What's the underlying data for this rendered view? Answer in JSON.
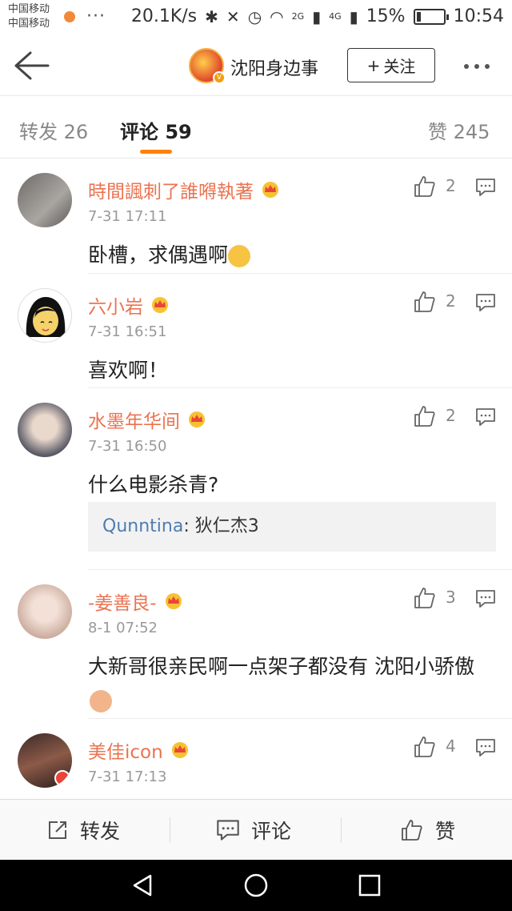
{
  "status_bar": {
    "carrier1": "中国移动",
    "carrier2": "中国移动",
    "dots": "···",
    "speed": "20.1K/s",
    "net1": "2G",
    "net2": "4G",
    "battery": "15%",
    "time": "10:54"
  },
  "nav": {
    "title": "沈阳身边事",
    "follow_label": "关注",
    "follow_plus": "+"
  },
  "tabs": [
    {
      "label": "转发",
      "count": "26"
    },
    {
      "label": "评论",
      "count": "59"
    },
    {
      "label": "赞",
      "count": "245"
    }
  ],
  "comments": [
    {
      "user": "時間諷刺了誰嘚執著",
      "time": "7-31 17:11",
      "text": "卧槽，求偶遇啊",
      "likes": "2"
    },
    {
      "user": "六小岩",
      "time": "7-31 16:51",
      "text": "喜欢啊！",
      "likes": "2"
    },
    {
      "user": "水墨年华间",
      "time": "7-31 16:50",
      "text": "什么电影杀青?",
      "likes": "2",
      "reply": {
        "user": "Qunntina",
        "sep": ": ",
        "text": "狄仁杰3"
      }
    },
    {
      "user": "-姜善良-",
      "time": "8-1 07:52",
      "text": "大新哥很亲民啊一点架子都没有 沈阳小骄傲",
      "likes": "3"
    },
    {
      "user": "美佳icon",
      "time": "7-31 17:13",
      "text": "",
      "likes": "4"
    }
  ],
  "bottom_bar": {
    "repost": "转发",
    "comment": "评论",
    "like": "赞"
  },
  "colors": {
    "accent": "#ff8200",
    "username": "#eb7350",
    "link": "#507daf"
  }
}
